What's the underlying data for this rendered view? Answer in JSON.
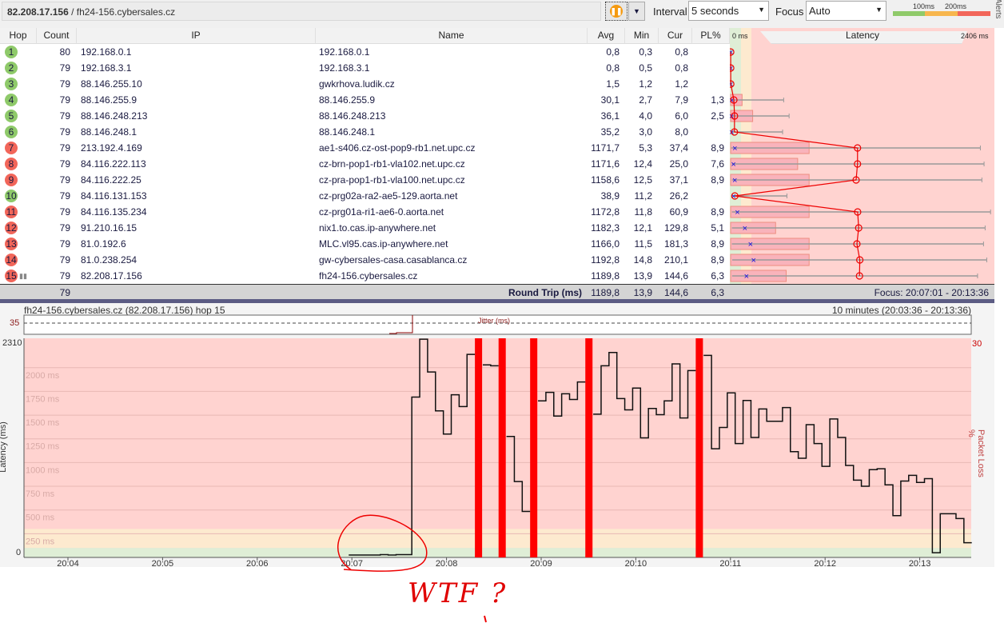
{
  "toolbar": {
    "address_ip": "82.208.17.156",
    "address_host": " / fh24-156.cybersales.cz",
    "pause_icon": "pause-icon",
    "interval_label": "Interval",
    "interval_value": "5 seconds",
    "focus_label": "Focus",
    "focus_value": "Auto",
    "legend_100": "100ms",
    "legend_200": "200ms",
    "alerts": "Alerts",
    "colors": {
      "good": "#8fca6a",
      "warn": "#f7b64e",
      "bad": "#f2665a"
    }
  },
  "table": {
    "headers": {
      "hop": "Hop",
      "count": "Count",
      "ip": "IP",
      "name": "Name",
      "avg": "Avg",
      "min": "Min",
      "cur": "Cur",
      "pl": "PL%",
      "graph_min": "0 ms",
      "graph_title": "Latency",
      "graph_max": "2406 ms"
    },
    "graph_max_ms": 2406,
    "pl_scale_max": 30,
    "rows": [
      {
        "hop": "1",
        "status": "good",
        "count": "80",
        "ip": "192.168.0.1",
        "name": "192.168.0.1",
        "avg": "0,8",
        "min": "0,3",
        "cur": "0,8",
        "pl": "",
        "max_ms": 2
      },
      {
        "hop": "2",
        "status": "good",
        "count": "79",
        "ip": "192.168.3.1",
        "name": "192.168.3.1",
        "avg": "0,8",
        "min": "0,5",
        "cur": "0,8",
        "pl": "",
        "max_ms": 2
      },
      {
        "hop": "3",
        "status": "good",
        "count": "79",
        "ip": "88.146.255.10",
        "name": "gwkrhova.ludik.cz",
        "avg": "1,5",
        "min": "1,2",
        "cur": "1,2",
        "pl": "",
        "max_ms": 3
      },
      {
        "hop": "4",
        "status": "good",
        "count": "79",
        "ip": "88.146.255.9",
        "name": "88.146.255.9",
        "avg": "30,1",
        "min": "2,7",
        "cur": "7,9",
        "pl": "1,3",
        "max_ms": 490
      },
      {
        "hop": "5",
        "status": "good",
        "count": "79",
        "ip": "88.146.248.213",
        "name": "88.146.248.213",
        "avg": "36,1",
        "min": "4,0",
        "cur": "6,0",
        "pl": "2,5",
        "max_ms": 540
      },
      {
        "hop": "6",
        "status": "good",
        "count": "79",
        "ip": "88.146.248.1",
        "name": "88.146.248.1",
        "avg": "35,2",
        "min": "3,0",
        "cur": "8,0",
        "pl": "",
        "max_ms": 480
      },
      {
        "hop": "7",
        "status": "bad",
        "count": "79",
        "ip": "213.192.4.169",
        "name": "ae1-s406.cz-ost-pop9-rb1.net.upc.cz",
        "avg": "1171,7",
        "min": "5,3",
        "cur": "37,4",
        "pl": "8,9",
        "max_ms": 2306
      },
      {
        "hop": "8",
        "status": "bad",
        "count": "79",
        "ip": "84.116.222.113",
        "name": "cz-brn-pop1-rb1-vla102.net.upc.cz",
        "avg": "1171,6",
        "min": "12,4",
        "cur": "25,0",
        "pl": "7,6",
        "max_ms": 2340
      },
      {
        "hop": "9",
        "status": "bad",
        "count": "79",
        "ip": "84.116.222.25",
        "name": "cz-pra-pop1-rb1-vla100.net.upc.cz",
        "avg": "1158,6",
        "min": "12,5",
        "cur": "37,1",
        "pl": "8,9",
        "max_ms": 2320
      },
      {
        "hop": "10",
        "status": "good",
        "count": "79",
        "ip": "84.116.131.153",
        "name": "cz-prg02a-ra2-ae5-129.aorta.net",
        "avg": "38,9",
        "min": "11,2",
        "cur": "26,2",
        "pl": "",
        "max_ms": 520
      },
      {
        "hop": "11",
        "status": "bad",
        "count": "79",
        "ip": "84.116.135.234",
        "name": "cz-prg01a-ri1-ae6-0.aorta.net",
        "avg": "1172,8",
        "min": "11,8",
        "cur": "60,9",
        "pl": "8,9",
        "max_ms": 2400
      },
      {
        "hop": "12",
        "status": "bad",
        "count": "79",
        "ip": "91.210.16.15",
        "name": "nix1.to.cas.ip-anywhere.net",
        "avg": "1182,3",
        "min": "12,1",
        "cur": "129,8",
        "pl": "5,1",
        "max_ms": 2350
      },
      {
        "hop": "13",
        "status": "bad",
        "count": "79",
        "ip": "81.0.192.6",
        "name": "MLC.vl95.cas.ip-anywhere.net",
        "avg": "1166,0",
        "min": "11,5",
        "cur": "181,3",
        "pl": "8,9",
        "max_ms": 2335
      },
      {
        "hop": "14",
        "status": "bad",
        "count": "79",
        "ip": "81.0.238.254",
        "name": "gw-cybersales-casa.casablanca.cz",
        "avg": "1192,8",
        "min": "14,8",
        "cur": "210,1",
        "pl": "8,9",
        "max_ms": 2365
      },
      {
        "hop": "15",
        "status": "bad",
        "count": "79",
        "ip": "82.208.17.156",
        "name": "fh24-156.cybersales.cz",
        "avg": "1189,8",
        "min": "13,9",
        "cur": "144,6",
        "pl": "6,3",
        "max_ms": 2280
      }
    ],
    "footer": {
      "count": "79",
      "label": "Round Trip (ms)",
      "avg": "1189,8",
      "min": "13,9",
      "cur": "144,6",
      "pl": "6,3",
      "focus": "Focus: 20:07:01 - 20:13:36"
    }
  },
  "detail": {
    "title": "fh24-156.cybersales.cz (82.208.17.156) hop 15",
    "range": "10 minutes (20:03:36 - 20:13:36)",
    "jitter_max": "35",
    "jitter_label": "Jitter (ms)"
  },
  "chart_data": {
    "type": "line",
    "step": true,
    "ylabel": "Latency (ms)",
    "y2label": "Packet Loss %",
    "ymax_label": "2310",
    "ymin_label": "0",
    "y2max_label": "30",
    "ylim": [
      0,
      2310
    ],
    "y_gridlines": [
      "250 ms",
      "500 ms",
      "750 ms",
      "1000 ms",
      "1250 ms",
      "1500 ms",
      "1750 ms",
      "2000 ms"
    ],
    "x_ticks": [
      "20:04",
      "20:05",
      "20:06",
      "20:07",
      "20:08",
      "20:09",
      "20:10",
      "20:11",
      "20:12",
      "20:13"
    ],
    "x_range": [
      "20:03:36",
      "20:13:36"
    ],
    "series_start": "20:06:58",
    "interval_s": 5,
    "values": [
      25,
      25,
      25,
      25,
      30,
      25,
      30,
      30,
      1690,
      2300,
      1955,
      1545,
      1300,
      1715,
      1590,
      2140,
      null,
      2030,
      2020,
      null,
      1275,
      800,
      485,
      null,
      1650,
      1740,
      1490,
      1725,
      1665,
      1850,
      null,
      1510,
      2020,
      2160,
      1675,
      1555,
      1785,
      1260,
      1570,
      1505,
      1650,
      2040,
      1470,
      1970,
      null,
      2130,
      1145,
      1370,
      1735,
      1200,
      1655,
      1265,
      1565,
      1435,
      1435,
      1580,
      1115,
      1045,
      1400,
      1200,
      960,
      1460,
      1265,
      970,
      815,
      750,
      925,
      935,
      765,
      440,
      805,
      865,
      790,
      830,
      50,
      460,
      460,
      410,
      155
    ],
    "packet_loss_times": [
      "20:08:18",
      "20:08:33",
      "20:08:53",
      "20:09:28",
      "20:10:38"
    ],
    "bands": {
      "good": "#dfeed6",
      "warn": "#fdeacf",
      "bad": "#ffd3d0"
    }
  },
  "annotation": {
    "text": "WTF ?"
  }
}
